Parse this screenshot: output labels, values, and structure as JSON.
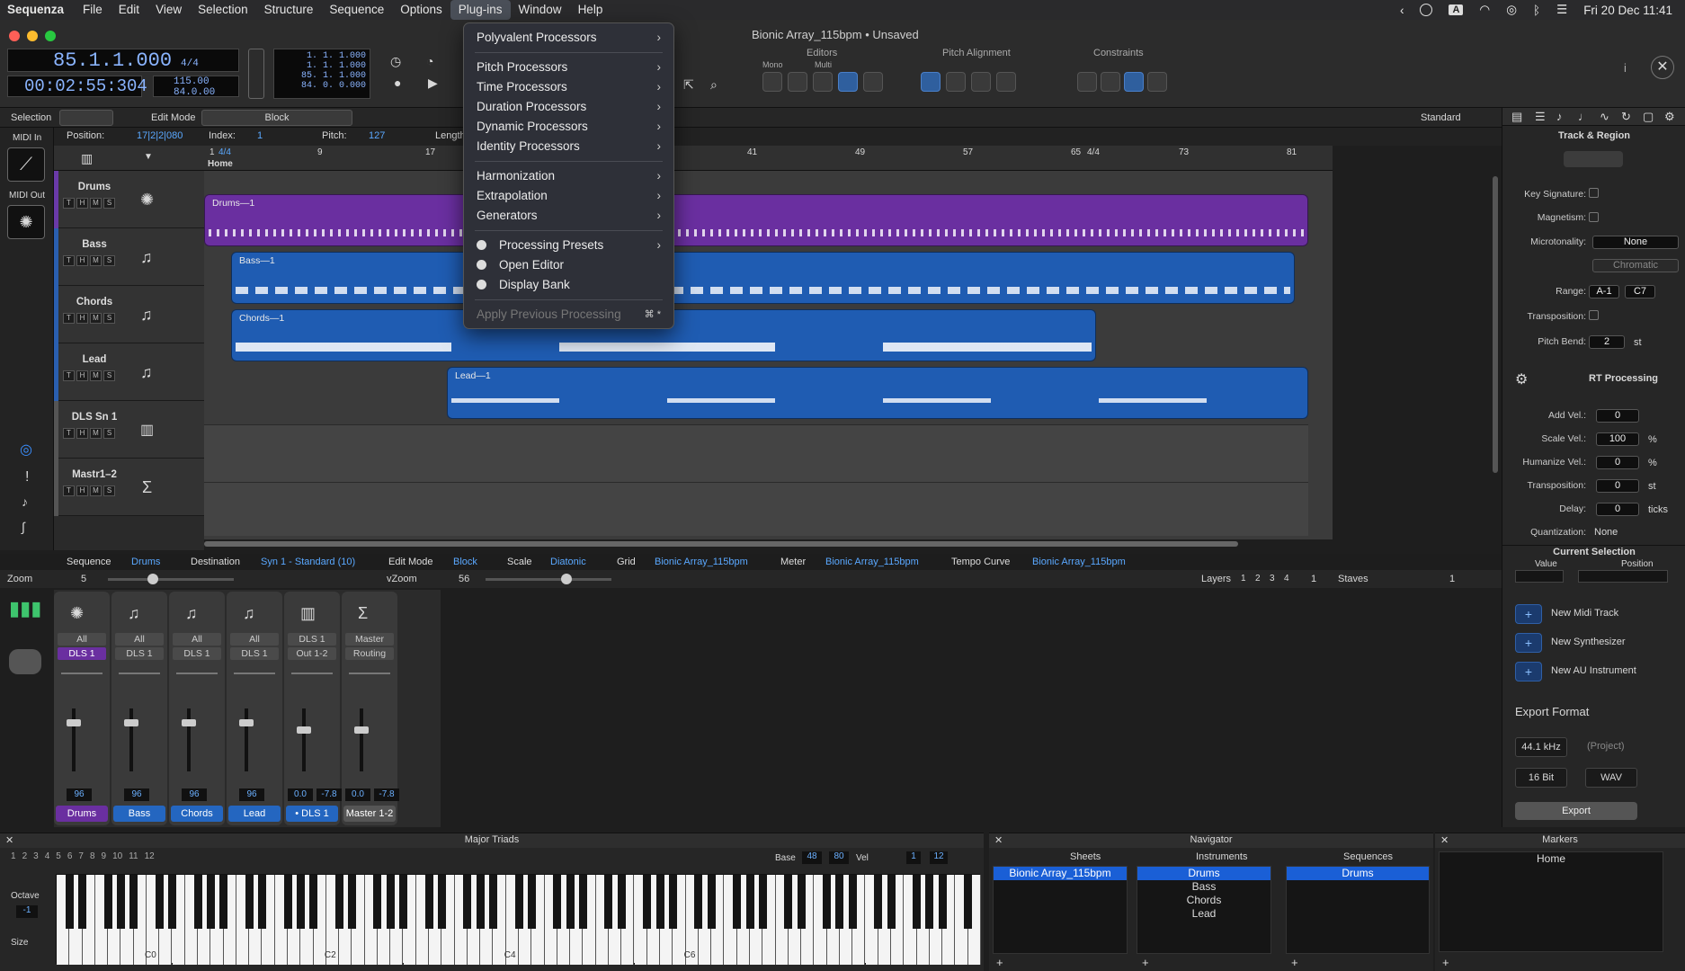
{
  "menubar": {
    "app": "Sequenza",
    "items": [
      "File",
      "Edit",
      "View",
      "Selection",
      "Structure",
      "Sequence",
      "Options",
      "Plug-ins",
      "Window",
      "Help"
    ],
    "active": "Plug-ins",
    "clock": "Fri 20 Dec  11:41",
    "input_source": "A"
  },
  "window": {
    "title": "Bionic Array_115bpm • Unsaved"
  },
  "transport": {
    "position": "85.1.1.000",
    "time": "00:02:55:304",
    "signature": "4/4",
    "tempo": "115.00",
    "tempo2": "84.0.00",
    "counter_lines": [
      "1. 1. 1.000",
      "1. 1. 1.000",
      "85. 1. 1.000",
      "84. 0. 0.000"
    ]
  },
  "toolbar": {
    "editors_label": "Editors",
    "mono": "Mono",
    "multi": "Multi",
    "pitch_alignment": "Pitch Alignment",
    "constraints": "Constraints"
  },
  "row2": {
    "selection": "Selection",
    "edit_mode_label": "Edit Mode",
    "edit_mode": "Block",
    "standard": "Standard"
  },
  "infobar": {
    "midi_in": "MIDI In",
    "midi_out": "MIDI Out",
    "position_label": "Position:",
    "position": "17|2|2|080",
    "index_label": "Index:",
    "index": "1",
    "pitch_label": "Pitch:",
    "pitch": "127",
    "length_label": "Length"
  },
  "ruler": {
    "marks": [
      "1",
      "9",
      "17",
      "41",
      "49",
      "57",
      "65",
      "73",
      "81"
    ],
    "sig": "4/4",
    "sig2": "4/4",
    "home": "Home"
  },
  "tracks": [
    {
      "name": "Drums",
      "color": "#6a3aa8"
    },
    {
      "name": "Bass",
      "color": "#2a5fb0"
    },
    {
      "name": "Chords",
      "color": "#2a5fb0"
    },
    {
      "name": "Lead",
      "color": "#2a5fb0"
    },
    {
      "name": "DLS Sn 1",
      "color": "#555555"
    },
    {
      "name": "Mastr1–2",
      "color": "#555555"
    }
  ],
  "track_buttons": [
    "T",
    "H",
    "M",
    "S"
  ],
  "regions": [
    {
      "label": "Drums—1",
      "color": "#6a2fa0"
    },
    {
      "label": "Bass—1",
      "color": "#1f5cb2"
    },
    {
      "label": "Chords—1",
      "color": "#1f5cb2"
    },
    {
      "label": "Lead—1",
      "color": "#1f5cb2"
    }
  ],
  "plugins_menu": {
    "items": [
      {
        "label": "Polyvalent Processors",
        "sub": true
      },
      {
        "sep": true
      },
      {
        "label": "Pitch Processors",
        "sub": true
      },
      {
        "label": "Time Processors",
        "sub": true
      },
      {
        "label": "Duration Processors",
        "sub": true
      },
      {
        "label": "Dynamic Processors",
        "sub": true
      },
      {
        "label": "Identity Processors",
        "sub": true
      },
      {
        "sep": true
      },
      {
        "label": "Harmonization",
        "sub": true
      },
      {
        "label": "Extrapolation",
        "sub": true
      },
      {
        "label": "Generators",
        "sub": true
      },
      {
        "sep": true
      },
      {
        "label": "Processing Presets",
        "sub": true,
        "gear": true
      },
      {
        "label": "Open Editor",
        "gear": true
      },
      {
        "label": "Display Bank",
        "gear": true
      },
      {
        "sep": true
      },
      {
        "label": "Apply Previous Processing",
        "disabled": true,
        "shortcut": "⌘ *"
      }
    ]
  },
  "inspector": {
    "title": "Track & Region",
    "key_signature": "Key Signature:",
    "magnetism": "Magnetism:",
    "microtonality": "Microtonality:",
    "microtonality_val": "None",
    "chromatic": "Chromatic",
    "range": "Range:",
    "range_lo": "A-1",
    "range_hi": "C7",
    "transposition": "Transposition:",
    "pitch_bend": "Pitch Bend:",
    "pitch_bend_val": "2",
    "st": "st",
    "rt_processing": "RT Processing",
    "add_vel": "Add Vel.:",
    "add_vel_val": "0",
    "scale_vel": "Scale Vel.:",
    "scale_vel_val": "100",
    "pct": "%",
    "humanize_vel": "Humanize Vel.:",
    "humanize_vel_val": "0",
    "transposition2": "Transposition:",
    "transposition2_val": "0",
    "delay": "Delay:",
    "delay_val": "0",
    "ticks": "ticks",
    "quantization": "Quantization:",
    "quantization_val": "None",
    "current_selection": "Current Selection",
    "value": "Value",
    "position": "Position",
    "new_midi_track": "New Midi Track",
    "new_synth": "New Synthesizer",
    "new_au": "New AU Instrument",
    "export_format": "Export Format",
    "khz": "44.1 kHz",
    "project": "(Project)",
    "bit": "16 Bit",
    "wav": "WAV",
    "export": "Export"
  },
  "status": {
    "sequence_k": "Sequence",
    "sequence_v": "Drums",
    "destination_k": "Destination",
    "destination_v": "Syn 1 - Standard (10)",
    "editmode_k": "Edit Mode",
    "editmode_v": "Block",
    "scale_k": "Scale",
    "scale_v": "Diatonic",
    "grid_k": "Grid",
    "grid_v": "Bionic Array_115bpm",
    "meter_k": "Meter",
    "meter_v": "Bionic Array_115bpm",
    "tempo_k": "Tempo Curve",
    "tempo_v": "Bionic Array_115bpm"
  },
  "zoom": {
    "label": "Zoom",
    "value": "5",
    "vzoom": "vZoom",
    "vvalue": "56",
    "layers": "Layers",
    "staves": "Staves",
    "layer_nums": [
      "1",
      "2",
      "3",
      "4"
    ],
    "layer_sel": "1"
  },
  "mixer": [
    {
      "name": "Drums",
      "top": "All",
      "mid": "DLS 1",
      "val": "96",
      "color": "#6a2fa0"
    },
    {
      "name": "Bass",
      "top": "All",
      "mid": "DLS 1",
      "val": "96",
      "color": "#2466c0"
    },
    {
      "name": "Chords",
      "top": "All",
      "mid": "DLS 1",
      "val": "96",
      "color": "#2466c0"
    },
    {
      "name": "Lead",
      "top": "All",
      "mid": "DLS 1",
      "val": "96",
      "color": "#2466c0"
    },
    {
      "name": "• DLS 1",
      "top": "DLS 1",
      "mid": "Out 1-2",
      "val": "0.0",
      "val2": "-7.8",
      "color": "#2466c0"
    },
    {
      "name": "Master 1-2",
      "top": "Master",
      "mid": "Routing",
      "val": "0.0",
      "val2": "-7.8",
      "color": "#555"
    }
  ],
  "keyboard": {
    "title": "Major Triads",
    "numbers": [
      "1",
      "2",
      "3",
      "4",
      "5",
      "6",
      "7",
      "8",
      "9",
      "10",
      "11",
      "12"
    ],
    "base_label": "Base",
    "base": "48",
    "base2": "80",
    "vel": "Vel",
    "ch": "1",
    "ch2": "12",
    "octave": "Octave",
    "octave_val": "-1",
    "size": "Size",
    "c_labels": [
      "C0",
      "C2",
      "C4",
      "C6"
    ]
  },
  "navigator": {
    "title": "Navigator",
    "sheets": "Sheets",
    "instruments": "Instruments",
    "sequences": "Sequences",
    "sheet_items": [
      "Bionic Array_115bpm"
    ],
    "instrument_items": [
      "Drums",
      "Bass",
      "Chords",
      "Lead"
    ],
    "sequence_items": [
      "Drums"
    ]
  },
  "markers": {
    "title": "Markers",
    "items": [
      "Home"
    ]
  }
}
